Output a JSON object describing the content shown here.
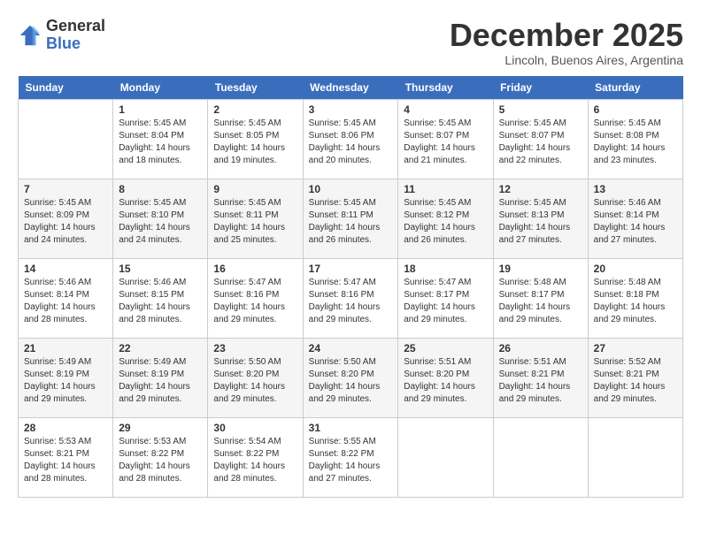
{
  "logo": {
    "general": "General",
    "blue": "Blue"
  },
  "header": {
    "month": "December 2025",
    "location": "Lincoln, Buenos Aires, Argentina"
  },
  "days_of_week": [
    "Sunday",
    "Monday",
    "Tuesday",
    "Wednesday",
    "Thursday",
    "Friday",
    "Saturday"
  ],
  "weeks": [
    [
      {
        "day": "",
        "info": ""
      },
      {
        "day": "1",
        "info": "Sunrise: 5:45 AM\nSunset: 8:04 PM\nDaylight: 14 hours\nand 18 minutes."
      },
      {
        "day": "2",
        "info": "Sunrise: 5:45 AM\nSunset: 8:05 PM\nDaylight: 14 hours\nand 19 minutes."
      },
      {
        "day": "3",
        "info": "Sunrise: 5:45 AM\nSunset: 8:06 PM\nDaylight: 14 hours\nand 20 minutes."
      },
      {
        "day": "4",
        "info": "Sunrise: 5:45 AM\nSunset: 8:07 PM\nDaylight: 14 hours\nand 21 minutes."
      },
      {
        "day": "5",
        "info": "Sunrise: 5:45 AM\nSunset: 8:07 PM\nDaylight: 14 hours\nand 22 minutes."
      },
      {
        "day": "6",
        "info": "Sunrise: 5:45 AM\nSunset: 8:08 PM\nDaylight: 14 hours\nand 23 minutes."
      }
    ],
    [
      {
        "day": "7",
        "info": "Sunrise: 5:45 AM\nSunset: 8:09 PM\nDaylight: 14 hours\nand 24 minutes."
      },
      {
        "day": "8",
        "info": "Sunrise: 5:45 AM\nSunset: 8:10 PM\nDaylight: 14 hours\nand 24 minutes."
      },
      {
        "day": "9",
        "info": "Sunrise: 5:45 AM\nSunset: 8:11 PM\nDaylight: 14 hours\nand 25 minutes."
      },
      {
        "day": "10",
        "info": "Sunrise: 5:45 AM\nSunset: 8:11 PM\nDaylight: 14 hours\nand 26 minutes."
      },
      {
        "day": "11",
        "info": "Sunrise: 5:45 AM\nSunset: 8:12 PM\nDaylight: 14 hours\nand 26 minutes."
      },
      {
        "day": "12",
        "info": "Sunrise: 5:45 AM\nSunset: 8:13 PM\nDaylight: 14 hours\nand 27 minutes."
      },
      {
        "day": "13",
        "info": "Sunrise: 5:46 AM\nSunset: 8:14 PM\nDaylight: 14 hours\nand 27 minutes."
      }
    ],
    [
      {
        "day": "14",
        "info": "Sunrise: 5:46 AM\nSunset: 8:14 PM\nDaylight: 14 hours\nand 28 minutes."
      },
      {
        "day": "15",
        "info": "Sunrise: 5:46 AM\nSunset: 8:15 PM\nDaylight: 14 hours\nand 28 minutes."
      },
      {
        "day": "16",
        "info": "Sunrise: 5:47 AM\nSunset: 8:16 PM\nDaylight: 14 hours\nand 29 minutes."
      },
      {
        "day": "17",
        "info": "Sunrise: 5:47 AM\nSunset: 8:16 PM\nDaylight: 14 hours\nand 29 minutes."
      },
      {
        "day": "18",
        "info": "Sunrise: 5:47 AM\nSunset: 8:17 PM\nDaylight: 14 hours\nand 29 minutes."
      },
      {
        "day": "19",
        "info": "Sunrise: 5:48 AM\nSunset: 8:17 PM\nDaylight: 14 hours\nand 29 minutes."
      },
      {
        "day": "20",
        "info": "Sunrise: 5:48 AM\nSunset: 8:18 PM\nDaylight: 14 hours\nand 29 minutes."
      }
    ],
    [
      {
        "day": "21",
        "info": "Sunrise: 5:49 AM\nSunset: 8:19 PM\nDaylight: 14 hours\nand 29 minutes."
      },
      {
        "day": "22",
        "info": "Sunrise: 5:49 AM\nSunset: 8:19 PM\nDaylight: 14 hours\nand 29 minutes."
      },
      {
        "day": "23",
        "info": "Sunrise: 5:50 AM\nSunset: 8:20 PM\nDaylight: 14 hours\nand 29 minutes."
      },
      {
        "day": "24",
        "info": "Sunrise: 5:50 AM\nSunset: 8:20 PM\nDaylight: 14 hours\nand 29 minutes."
      },
      {
        "day": "25",
        "info": "Sunrise: 5:51 AM\nSunset: 8:20 PM\nDaylight: 14 hours\nand 29 minutes."
      },
      {
        "day": "26",
        "info": "Sunrise: 5:51 AM\nSunset: 8:21 PM\nDaylight: 14 hours\nand 29 minutes."
      },
      {
        "day": "27",
        "info": "Sunrise: 5:52 AM\nSunset: 8:21 PM\nDaylight: 14 hours\nand 29 minutes."
      }
    ],
    [
      {
        "day": "28",
        "info": "Sunrise: 5:53 AM\nSunset: 8:21 PM\nDaylight: 14 hours\nand 28 minutes."
      },
      {
        "day": "29",
        "info": "Sunrise: 5:53 AM\nSunset: 8:22 PM\nDaylight: 14 hours\nand 28 minutes."
      },
      {
        "day": "30",
        "info": "Sunrise: 5:54 AM\nSunset: 8:22 PM\nDaylight: 14 hours\nand 28 minutes."
      },
      {
        "day": "31",
        "info": "Sunrise: 5:55 AM\nSunset: 8:22 PM\nDaylight: 14 hours\nand 27 minutes."
      },
      {
        "day": "",
        "info": ""
      },
      {
        "day": "",
        "info": ""
      },
      {
        "day": "",
        "info": ""
      }
    ]
  ]
}
